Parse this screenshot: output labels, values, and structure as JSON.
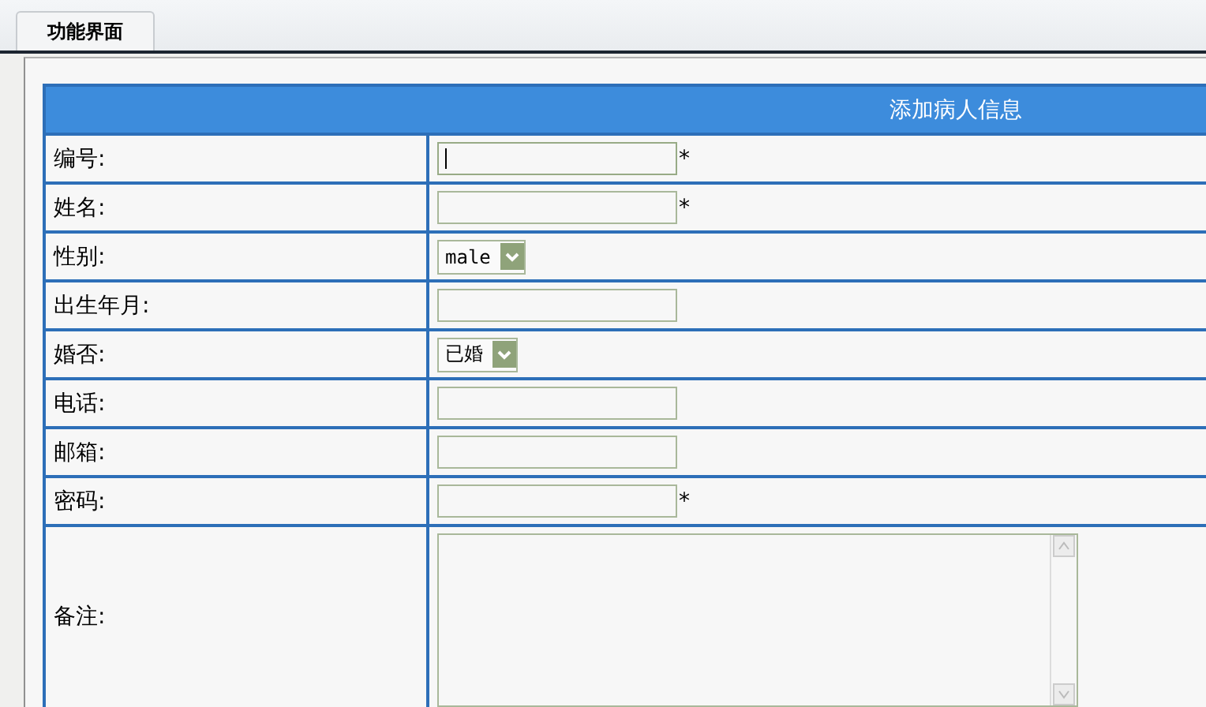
{
  "tabs": [
    {
      "label": "功能界面",
      "selected": true
    }
  ],
  "form": {
    "title": "添加病人信息",
    "rows": [
      {
        "label": "编号:",
        "kind": "text",
        "focused": true,
        "mark": "*"
      },
      {
        "label": "姓名:",
        "kind": "text",
        "focused": false,
        "mark": "*"
      },
      {
        "label": "性别:",
        "kind": "select",
        "value": "male"
      },
      {
        "label": "出生年月:",
        "kind": "text",
        "focused": false
      },
      {
        "label": "婚否:",
        "kind": "select",
        "value": "已婚"
      },
      {
        "label": "电话:",
        "kind": "text",
        "focused": false
      },
      {
        "label": "邮箱:",
        "kind": "text",
        "focused": false
      },
      {
        "label": "密码:",
        "kind": "text",
        "focused": false,
        "mark": "*"
      },
      {
        "label": "备注:",
        "kind": "textarea"
      }
    ]
  }
}
